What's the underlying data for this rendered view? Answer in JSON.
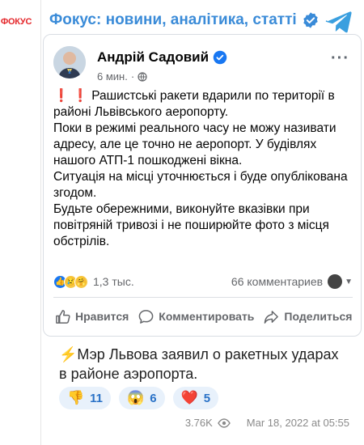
{
  "channel": {
    "avatar_text": "ФОКУС",
    "title": "Фокус: новини, аналітика, статті",
    "brand_color": "#3a8bd8",
    "logo_color": "#e4262a"
  },
  "fb_post": {
    "author": "Андрій Садовий",
    "time": "6 мин.",
    "more": "···",
    "excl": "❗ ❗",
    "paragraphs": [
      "Рашистські ракети вдарили по території в районі Львівського аеропорту.",
      "Поки в режимі реального часу не можу називати адресу, але це точно не аеропорт. У будівлях нашого АТП-1 пошкоджені вікна.",
      "Ситуація на місці уточнюється і буде опублікована згодом.",
      "Будьте обережними, виконуйте вказівки при повітряній тривозі і не поширюйте фото з місця обстрілів."
    ],
    "reaction_count": "1,3 тыс.",
    "comments": "66 комментариев",
    "actions": {
      "like": "Нравится",
      "comment": "Комментировать",
      "share": "Поделиться"
    }
  },
  "caption": {
    "icon": "⚡",
    "text": "Мэр Львова заявил о ракетных ударах в районе аэропорта."
  },
  "reactions": [
    {
      "emoji": "👎",
      "count": "11"
    },
    {
      "emoji": "😱",
      "count": "6"
    },
    {
      "emoji": "❤️",
      "count": "5"
    }
  ],
  "meta": {
    "views": "3.76K",
    "date": "Mar 18, 2022 at 05:55"
  }
}
